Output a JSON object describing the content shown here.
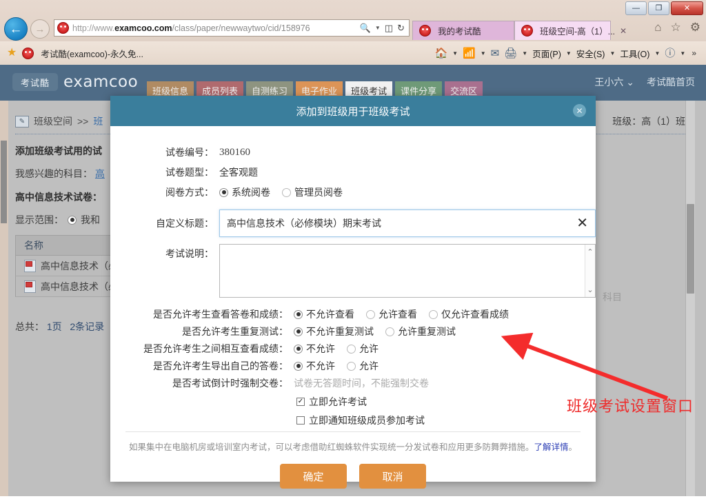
{
  "browser": {
    "window_buttons": {
      "minimize": "—",
      "maximize": "❐",
      "close": "✕"
    },
    "back_icon": "←",
    "forward_icon": "→",
    "url_scheme": "http://www.",
    "url_domain": "examcoo.com",
    "url_path": "/class/paper/newwaytwo/cid/158976",
    "url_full": "http://www.examcoo.com/class/paper/newwaytwo/cid/158976",
    "search_icon": "search-icon",
    "compat_icon": "compatibility-view-icon",
    "refresh_icon": "↻",
    "tabs": [
      {
        "label": "我的考试酷",
        "active": false
      },
      {
        "label": "班级空间-高（1）...",
        "active": true,
        "close": "✕"
      }
    ],
    "toolbar_right": [
      "home-icon",
      "feeds-icon",
      "mail-icon",
      "print-icon"
    ],
    "menus": [
      "页面(P)",
      "安全(S)",
      "工具(O)"
    ],
    "help_icon": "help-icon",
    "overflow": "»",
    "favorites": {
      "star_icon": "favorites-star-icon",
      "item_label": "考试酷(examcoo)-永久免..."
    }
  },
  "site": {
    "logo_badge": "考试酷",
    "logo_text": "examcoo",
    "nav_tabs": [
      {
        "label": "班级信息",
        "color": "#b08b63",
        "active": false
      },
      {
        "label": "成员列表",
        "color": "#b06a6e",
        "active": false
      },
      {
        "label": "自测练习",
        "color": "#8e9480",
        "active": false
      },
      {
        "label": "电子作业",
        "color": "#dc9457",
        "active": false
      },
      {
        "label": "班级考试",
        "color": "#f1f1f1",
        "active": true
      },
      {
        "label": "课件分享",
        "color": "#6f9a78",
        "active": false
      },
      {
        "label": "交流区",
        "color": "#a9708f",
        "active": false
      }
    ],
    "user_name": "王小六",
    "user_caret": "⌄",
    "home_link": "考试酷首页"
  },
  "page": {
    "breadcrumb_icon": "page-edit-icon",
    "breadcrumb_root": "班级空间",
    "breadcrumb_sep": ">>",
    "breadcrumb_current": "班",
    "class_label": "班级：高（1）班",
    "section_title": "添加班级考试用的试",
    "subject_row_label": "我感兴趣的科目：",
    "subject_row_value": "高",
    "paper_title": "高中信息技术试卷：",
    "range_label": "显示范围：",
    "range_option": "我和",
    "subject_right_text": "科目",
    "list_header": "名称",
    "list_rows": [
      {
        "icon": "exam-paper-icon",
        "label": "高中信息技术（必"
      },
      {
        "icon": "exam-paper-icon",
        "label": "高中信息技术（必"
      }
    ],
    "total_prefix": "总共：",
    "total_pages": "1页",
    "total_records": "2条记录"
  },
  "modal": {
    "title": "添加到班级用于班级考试",
    "close_icon": "✕",
    "paper_id_label": "试卷编号：",
    "paper_id_value": "380160",
    "paper_type_label": "试卷题型：",
    "paper_type_value": "全客观题",
    "marking_label": "阅卷方式：",
    "marking_options": [
      {
        "label": "系统阅卷",
        "selected": true
      },
      {
        "label": "管理员阅卷",
        "selected": false
      }
    ],
    "custom_title_label": "自定义标题：",
    "custom_title_value": "高中信息技术（必修模块）期末考试",
    "clear_icon": "✕",
    "desc_label": "考试说明：",
    "desc_value": "",
    "scroll_up_icon": "⌃",
    "scroll_down_icon": "⌄",
    "option_rows": [
      {
        "label": "是否允许考生查看答卷和成绩：",
        "options": [
          {
            "label": "不允许查看",
            "selected": true
          },
          {
            "label": "允许查看",
            "selected": false
          },
          {
            "label": "仅允许查看成绩",
            "selected": false
          }
        ]
      },
      {
        "label": "是否允许考生重复测试：",
        "options": [
          {
            "label": "不允许重复测试",
            "selected": true
          },
          {
            "label": "允许重复测试",
            "selected": false
          }
        ]
      },
      {
        "label": "是否允许考生之间相互查看成绩：",
        "options": [
          {
            "label": "不允许",
            "selected": true
          },
          {
            "label": "允许",
            "selected": false
          }
        ]
      },
      {
        "label": "是否允许考生导出自己的答卷：",
        "options": [
          {
            "label": "不允许",
            "selected": true
          },
          {
            "label": "允许",
            "selected": false
          }
        ]
      }
    ],
    "countdown_label": "是否考试倒计时强制交卷：",
    "countdown_hint": "试卷无答题时间，不能强制交卷",
    "checkboxes": [
      {
        "label": "立即允许考试",
        "checked": true,
        "mark": "✓"
      },
      {
        "label": "立即通知班级成员参加考试",
        "checked": false,
        "mark": ""
      }
    ],
    "note_text": "如果集中在电脑机房或培训室内考试，可以考虑借助红蜘蛛软件实现统一分发试卷和应用更多防舞弊措施。",
    "note_link": "了解详情",
    "note_tail": "。",
    "confirm_label": "确定",
    "cancel_label": "取消"
  },
  "annotation": {
    "text": "班级考试设置窗口",
    "color": "#ee2b2b",
    "arrow_name": "red-arrow-annotation"
  }
}
